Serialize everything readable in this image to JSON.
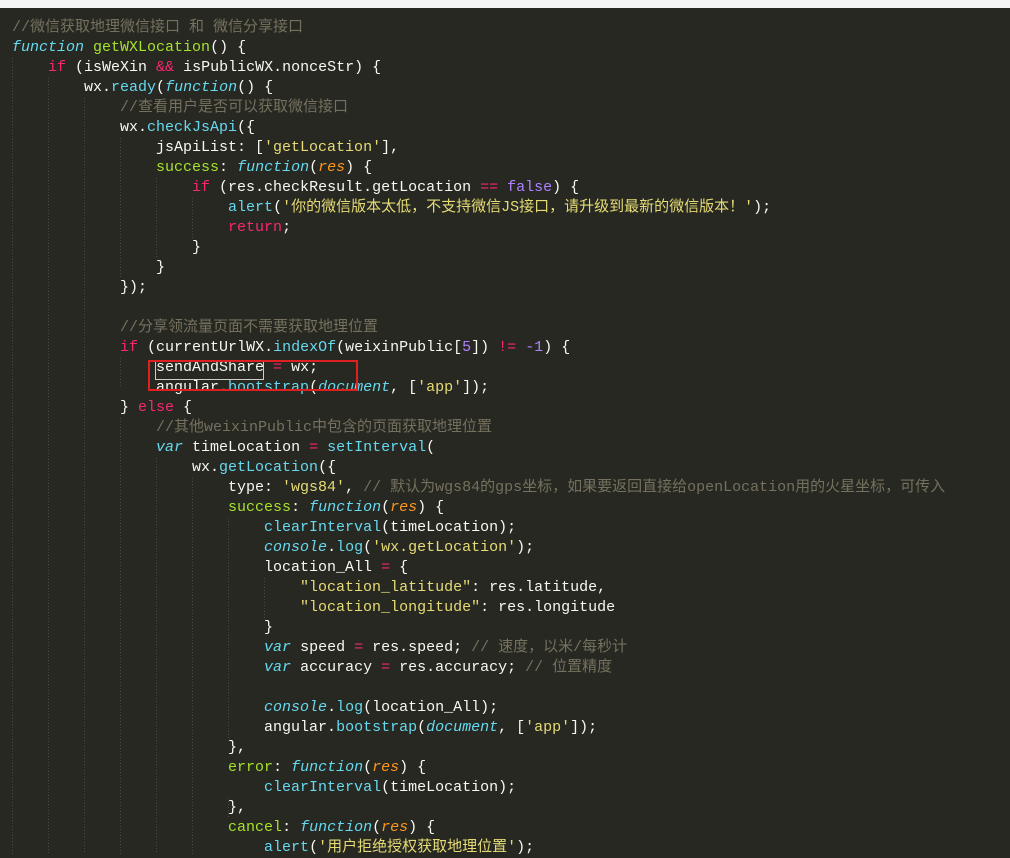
{
  "colors": {
    "background": "#272822",
    "text": "#f8f8f2",
    "keyword": "#66d9ef",
    "control": "#f92672",
    "function_name": "#a6e22e",
    "string": "#e6db74",
    "number": "#ae81ff",
    "comment": "#75715e",
    "parameter": "#fd971f",
    "highlight_box": "#e02020"
  },
  "code": {
    "lines": [
      [
        {
          "t": "//微信获取地理微信接口 和 微信分享接口",
          "c": "cmt"
        }
      ],
      [
        {
          "t": "function",
          "c": "kw"
        },
        {
          "t": " "
        },
        {
          "t": "getWXLocation",
          "c": "fn"
        },
        {
          "t": "() {"
        }
      ],
      [
        {
          "t": "    "
        },
        {
          "t": "if",
          "c": "ctl"
        },
        {
          "t": " (isWeXin "
        },
        {
          "t": "&&",
          "c": "op"
        },
        {
          "t": " isPublicWX.nonceStr) {"
        }
      ],
      [
        {
          "t": "        wx."
        },
        {
          "t": "ready",
          "c": "call"
        },
        {
          "t": "("
        },
        {
          "t": "function",
          "c": "kw"
        },
        {
          "t": "() {"
        }
      ],
      [
        {
          "t": "            "
        },
        {
          "t": "//查看用户是否可以获取微信接口",
          "c": "cmt"
        }
      ],
      [
        {
          "t": "            wx."
        },
        {
          "t": "checkJsApi",
          "c": "call"
        },
        {
          "t": "({"
        }
      ],
      [
        {
          "t": "                jsApiList: ["
        },
        {
          "t": "'getLocation'",
          "c": "str"
        },
        {
          "t": "],"
        }
      ],
      [
        {
          "t": "                "
        },
        {
          "t": "success",
          "c": "prop"
        },
        {
          "t": ": "
        },
        {
          "t": "function",
          "c": "kw"
        },
        {
          "t": "("
        },
        {
          "t": "res",
          "c": "par"
        },
        {
          "t": ") {"
        }
      ],
      [
        {
          "t": "                    "
        },
        {
          "t": "if",
          "c": "ctl"
        },
        {
          "t": " (res.checkResult.getLocation "
        },
        {
          "t": "==",
          "c": "op"
        },
        {
          "t": " "
        },
        {
          "t": "false",
          "c": "num"
        },
        {
          "t": ") {"
        }
      ],
      [
        {
          "t": "                        "
        },
        {
          "t": "alert",
          "c": "call"
        },
        {
          "t": "("
        },
        {
          "t": "'你的微信版本太低，不支持微信JS接口，请升级到最新的微信版本！'",
          "c": "str"
        },
        {
          "t": ");"
        }
      ],
      [
        {
          "t": "                        "
        },
        {
          "t": "return",
          "c": "ctl"
        },
        {
          "t": ";"
        }
      ],
      [
        {
          "t": "                    }"
        }
      ],
      [
        {
          "t": "                }"
        }
      ],
      [
        {
          "t": "            });"
        }
      ],
      [
        {
          "t": ""
        }
      ],
      [
        {
          "t": "            "
        },
        {
          "t": "//分享领流量页面不需要获取地理位置",
          "c": "cmt"
        }
      ],
      [
        {
          "t": "            "
        },
        {
          "t": "if",
          "c": "ctl"
        },
        {
          "t": " (currentUrlWX."
        },
        {
          "t": "indexOf",
          "c": "call"
        },
        {
          "t": "(weixinPublic["
        },
        {
          "t": "5",
          "c": "num"
        },
        {
          "t": "]) "
        },
        {
          "t": "!=",
          "c": "op"
        },
        {
          "t": " "
        },
        {
          "t": "-1",
          "c": "num"
        },
        {
          "t": ") {"
        }
      ],
      [
        {
          "t": "                sendAndShare "
        },
        {
          "t": "=",
          "c": "op"
        },
        {
          "t": " wx;"
        }
      ],
      [
        {
          "t": "                angular."
        },
        {
          "t": "bootstrap",
          "c": "call"
        },
        {
          "t": "("
        },
        {
          "t": "document",
          "c": "glob"
        },
        {
          "t": ", ["
        },
        {
          "t": "'app'",
          "c": "str"
        },
        {
          "t": "]);"
        }
      ],
      [
        {
          "t": "            } "
        },
        {
          "t": "else",
          "c": "ctl"
        },
        {
          "t": " {"
        }
      ],
      [
        {
          "t": "                "
        },
        {
          "t": "//其他weixinPublic中包含的页面获取地理位置",
          "c": "cmt"
        }
      ],
      [
        {
          "t": "                "
        },
        {
          "t": "var",
          "c": "kw"
        },
        {
          "t": " timeLocation "
        },
        {
          "t": "=",
          "c": "op"
        },
        {
          "t": " "
        },
        {
          "t": "setInterval",
          "c": "call"
        },
        {
          "t": "("
        }
      ],
      [
        {
          "t": "                    wx."
        },
        {
          "t": "getLocation",
          "c": "call"
        },
        {
          "t": "({"
        }
      ],
      [
        {
          "t": "                        type: "
        },
        {
          "t": "'wgs84'",
          "c": "str"
        },
        {
          "t": ", "
        },
        {
          "t": "// 默认为wgs84的gps坐标，如果要返回直接给openLocation用的火星坐标，可传入",
          "c": "cmt"
        }
      ],
      [
        {
          "t": "                        "
        },
        {
          "t": "success",
          "c": "prop"
        },
        {
          "t": ": "
        },
        {
          "t": "function",
          "c": "kw"
        },
        {
          "t": "("
        },
        {
          "t": "res",
          "c": "par"
        },
        {
          "t": ") {"
        }
      ],
      [
        {
          "t": "                            "
        },
        {
          "t": "clearInterval",
          "c": "call"
        },
        {
          "t": "(timeLocation);"
        }
      ],
      [
        {
          "t": "                            "
        },
        {
          "t": "console",
          "c": "glob"
        },
        {
          "t": "."
        },
        {
          "t": "log",
          "c": "call"
        },
        {
          "t": "("
        },
        {
          "t": "'wx.getLocation'",
          "c": "str"
        },
        {
          "t": ");"
        }
      ],
      [
        {
          "t": "                            location_All "
        },
        {
          "t": "=",
          "c": "op"
        },
        {
          "t": " {"
        }
      ],
      [
        {
          "t": "                                "
        },
        {
          "t": "\"location_latitude\"",
          "c": "str"
        },
        {
          "t": ": res.latitude,"
        }
      ],
      [
        {
          "t": "                                "
        },
        {
          "t": "\"location_longitude\"",
          "c": "str"
        },
        {
          "t": ": res.longitude"
        }
      ],
      [
        {
          "t": "                            }"
        }
      ],
      [
        {
          "t": "                            "
        },
        {
          "t": "var",
          "c": "kw"
        },
        {
          "t": " speed "
        },
        {
          "t": "=",
          "c": "op"
        },
        {
          "t": " res.speed; "
        },
        {
          "t": "// 速度，以米/每秒计",
          "c": "cmt"
        }
      ],
      [
        {
          "t": "                            "
        },
        {
          "t": "var",
          "c": "kw"
        },
        {
          "t": " accuracy "
        },
        {
          "t": "=",
          "c": "op"
        },
        {
          "t": " res.accuracy; "
        },
        {
          "t": "// 位置精度",
          "c": "cmt"
        }
      ],
      [
        {
          "t": ""
        }
      ],
      [
        {
          "t": "                            "
        },
        {
          "t": "console",
          "c": "glob"
        },
        {
          "t": "."
        },
        {
          "t": "log",
          "c": "call"
        },
        {
          "t": "(location_All);"
        }
      ],
      [
        {
          "t": "                            angular."
        },
        {
          "t": "bootstrap",
          "c": "call"
        },
        {
          "t": "("
        },
        {
          "t": "document",
          "c": "glob"
        },
        {
          "t": ", ["
        },
        {
          "t": "'app'",
          "c": "str"
        },
        {
          "t": "]);"
        }
      ],
      [
        {
          "t": "                        },"
        }
      ],
      [
        {
          "t": "                        "
        },
        {
          "t": "error",
          "c": "prop"
        },
        {
          "t": ": "
        },
        {
          "t": "function",
          "c": "kw"
        },
        {
          "t": "("
        },
        {
          "t": "res",
          "c": "par"
        },
        {
          "t": ") {"
        }
      ],
      [
        {
          "t": "                            "
        },
        {
          "t": "clearInterval",
          "c": "call"
        },
        {
          "t": "(timeLocation);"
        }
      ],
      [
        {
          "t": "                        },"
        }
      ],
      [
        {
          "t": "                        "
        },
        {
          "t": "cancel",
          "c": "prop"
        },
        {
          "t": ": "
        },
        {
          "t": "function",
          "c": "kw"
        },
        {
          "t": "("
        },
        {
          "t": "res",
          "c": "par"
        },
        {
          "t": ") {"
        }
      ],
      [
        {
          "t": "                            "
        },
        {
          "t": "alert",
          "c": "call"
        },
        {
          "t": "("
        },
        {
          "t": "'用户拒绝授权获取地理位置'",
          "c": "str"
        },
        {
          "t": ");"
        }
      ]
    ]
  }
}
